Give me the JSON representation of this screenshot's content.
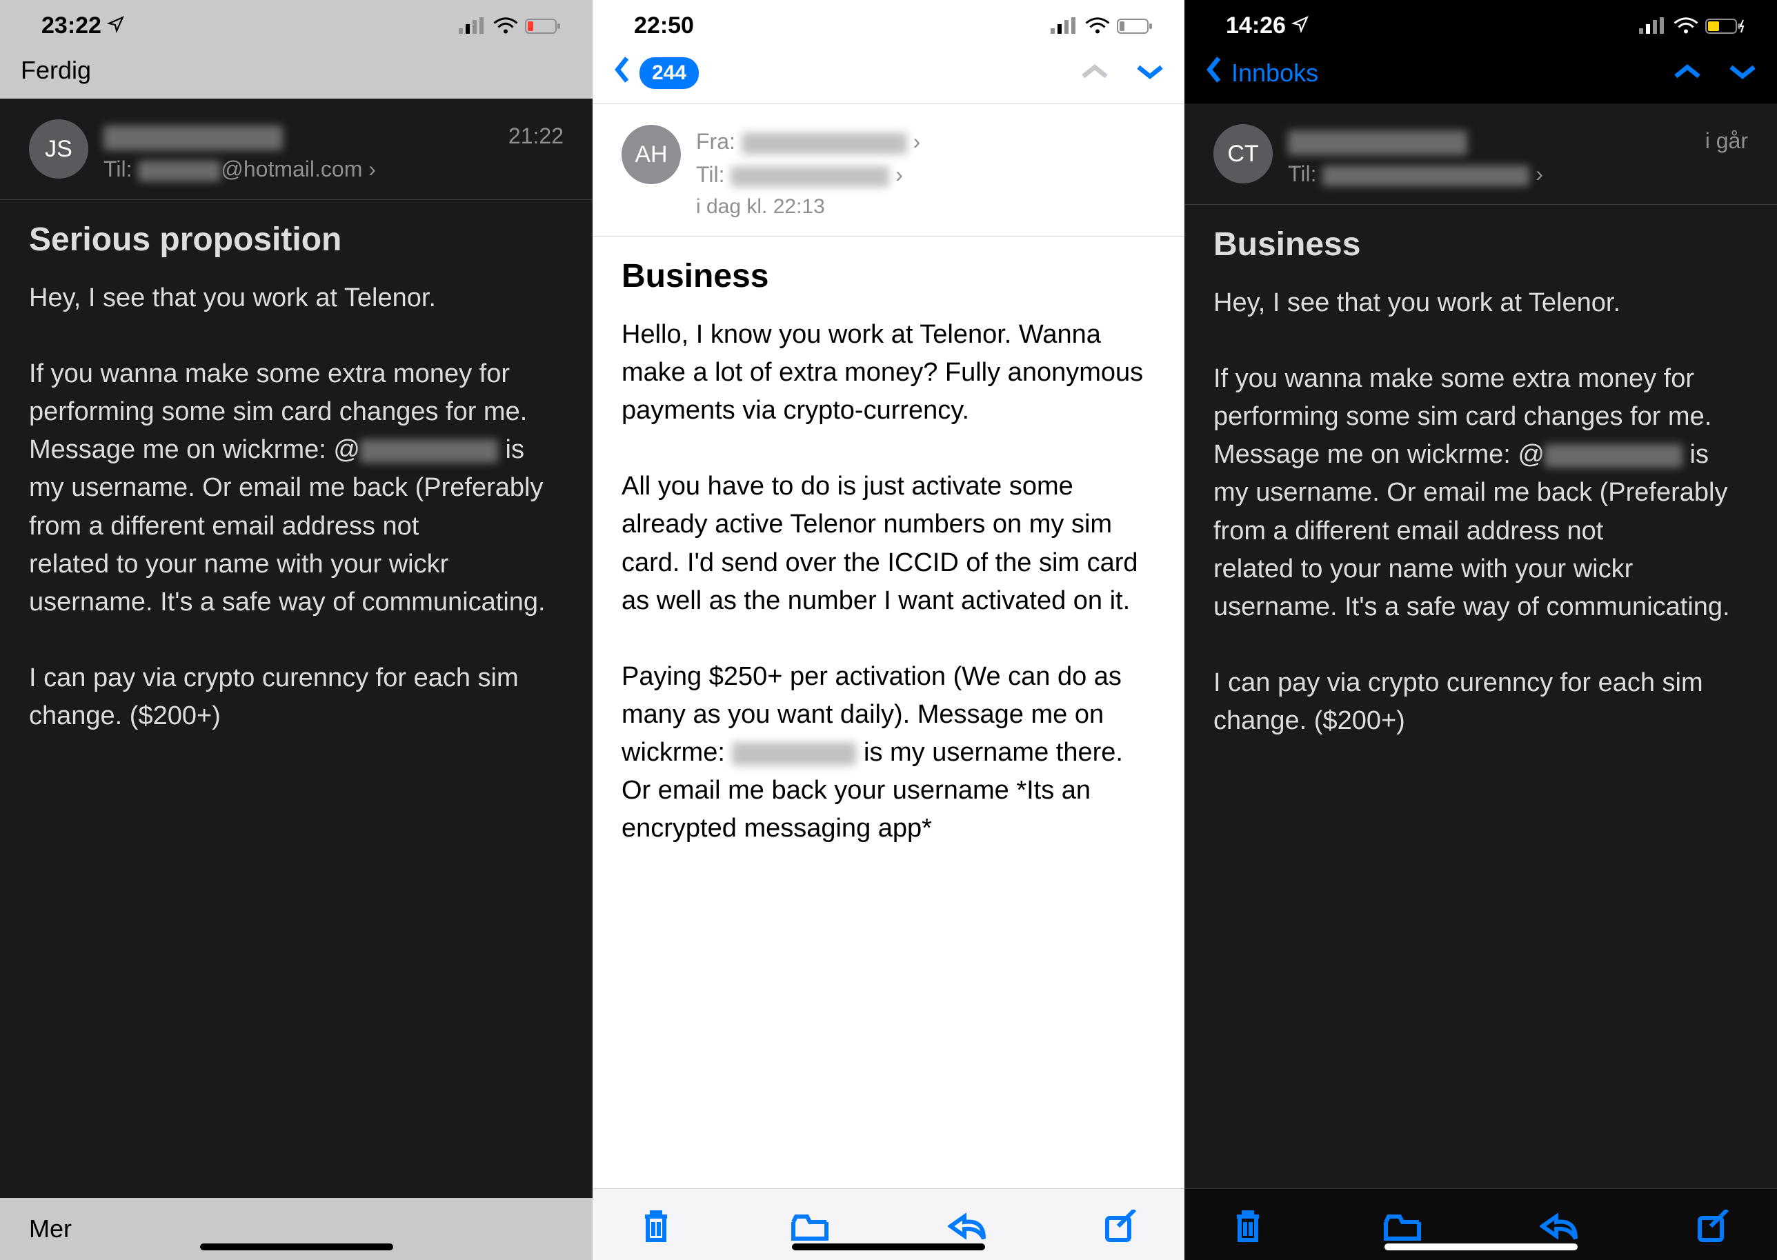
{
  "phones": [
    {
      "theme": "dark-light",
      "status_time": "23:22",
      "battery_state": "low-red",
      "nav_left": "Ferdig",
      "avatar": "JS",
      "from_redacted_w": "260",
      "to_label": "Til:",
      "to_value_prefix_redacted_w": "120",
      "to_value_suffix": "@hotmail.com",
      "time_right": "21:22",
      "subject": "Serious proposition",
      "body_parts": [
        "Hey, I see that you work at Telenor.\n\nIf you wanna make some extra money for performing some sim card changes for me. Message me on wickrme: @",
        {
          "redacted_w": "200"
        },
        " is my username. Or email me back (Preferably from a different email address not\nrelated to your name with your wickr username. It's a safe way of communicating.\n\nI can pay via crypto curenncy for each sim change. ($200+)"
      ],
      "bottom_left": "Mer"
    },
    {
      "theme": "white",
      "status_time": "22:50",
      "battery_state": "low-grey",
      "badge": "244",
      "avatar": "AH",
      "from_label": "Fra:",
      "from_redacted_w": "240",
      "to_label": "Til:",
      "to_redacted_w": "230",
      "ts_line": "i dag kl. 22:13",
      "subject": "Business",
      "body_parts": [
        "Hello, I know you work at Telenor. Wanna make a lot of extra money? Fully anonymous payments via crypto-currency.\n\nAll you have to do is just activate some already active Telenor numbers on my sim card. I'd send over the ICCID of the sim card as well as the number I want activated on it.\n\nPaying $250+ per activation (We can do as many as you want daily). Message me on wickrme: ",
        {
          "redacted_w": "180"
        },
        " is my username there. Or email me back your username *Its an encrypted messaging app*"
      ]
    },
    {
      "theme": "dark",
      "status_time": "14:26",
      "battery_state": "charging-yellow",
      "back_link": "Innboks",
      "avatar": "CT",
      "from_redacted_w": "260",
      "to_label": "Til:",
      "to_redacted_w": "300",
      "time_right": "i går",
      "subject": "Business",
      "body_parts": [
        "Hey, I see that you work at Telenor.\n\nIf you wanna make some extra money for performing some sim card changes for me. Message me on wickrme: @",
        {
          "redacted_w": "200"
        },
        " is my username. Or email me back (Preferably from a different email address not\nrelated to your name with your wickr username. It's a safe way of communicating.\n\nI can pay via crypto curenncy for each sim change. ($200+)"
      ]
    }
  ]
}
